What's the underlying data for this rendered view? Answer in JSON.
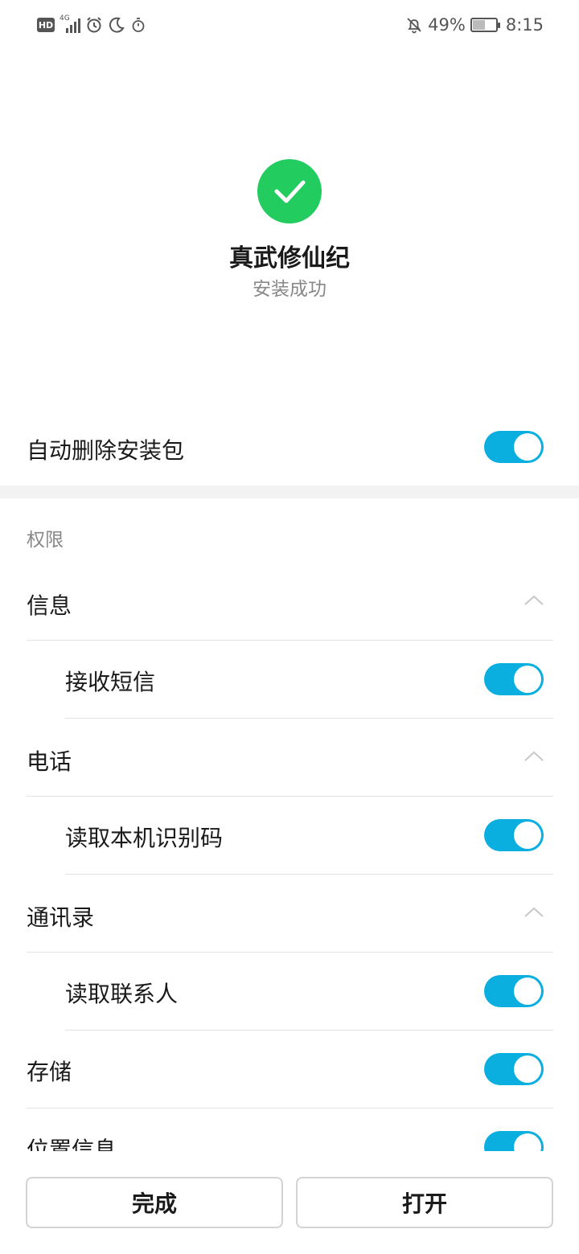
{
  "status_bar": {
    "hd": "HD",
    "network": "4G",
    "battery_percent": "49%",
    "time": "8:15",
    "icons_left": [
      "hd-icon",
      "signal-icon",
      "alarm-icon",
      "moon-icon",
      "timer-icon"
    ],
    "icons_right": [
      "bell-off-icon",
      "battery-icon"
    ]
  },
  "app": {
    "name": "真武修仙纪",
    "status": "安装成功"
  },
  "auto_delete": {
    "label": "自动删除安装包",
    "enabled": true
  },
  "permissions": {
    "title": "权限",
    "groups": [
      {
        "label": "信息",
        "expanded": true,
        "items": [
          {
            "label": "接收短信",
            "enabled": true
          }
        ]
      },
      {
        "label": "电话",
        "expanded": true,
        "items": [
          {
            "label": "读取本机识别码",
            "enabled": true
          }
        ]
      },
      {
        "label": "通讯录",
        "expanded": true,
        "items": [
          {
            "label": "读取联系人",
            "enabled": true
          }
        ]
      },
      {
        "label": "存储",
        "enabled": true
      },
      {
        "label": "位置信息",
        "enabled": true
      }
    ]
  },
  "buttons": {
    "done": "完成",
    "open": "打开"
  },
  "colors": {
    "accent": "#0aafe0",
    "success": "#22cc5e",
    "secondary_text": "#888888"
  }
}
